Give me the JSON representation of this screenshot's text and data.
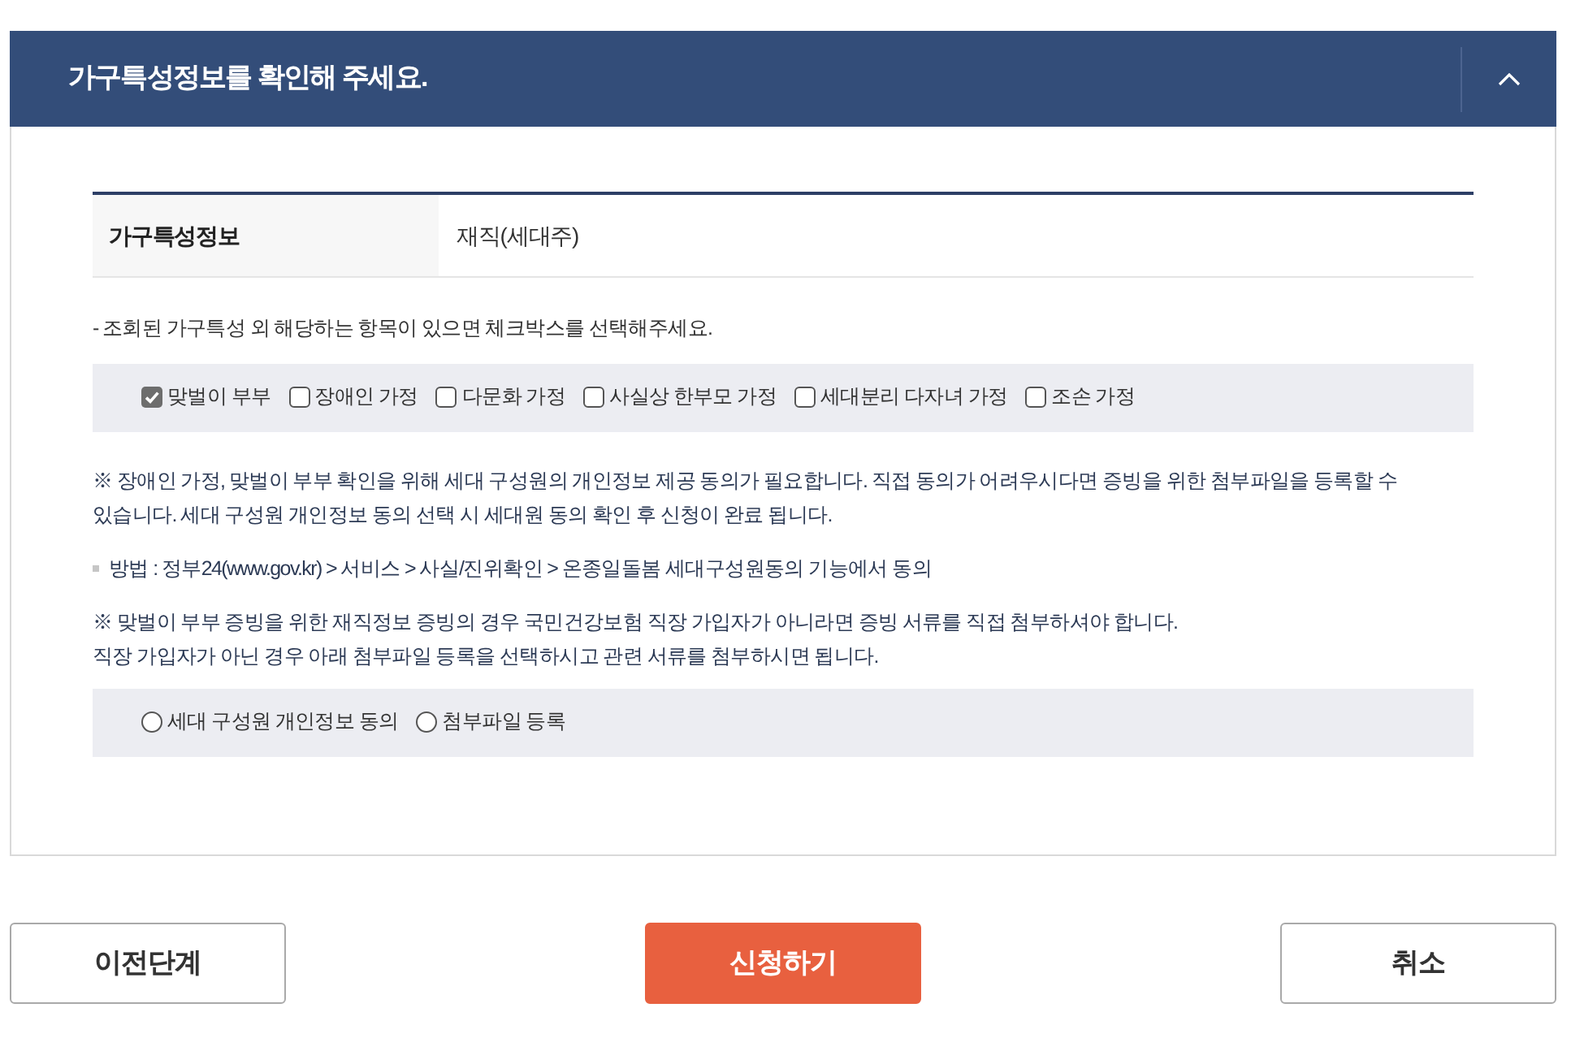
{
  "section": {
    "title": "가구특성정보를 확인해 주세요.",
    "expanded": true
  },
  "info_table": {
    "rows": [
      {
        "label": "가구특성정보",
        "value": "재직(세대주)"
      }
    ]
  },
  "instruction": "- 조회된 가구특성 외 해당하는 항목이 있으면 체크박스를 선택해주세요.",
  "household_types": [
    {
      "label": "맞벌이 부부",
      "checked": true
    },
    {
      "label": "장애인 가정",
      "checked": false
    },
    {
      "label": "다문화 가정",
      "checked": false
    },
    {
      "label": "사실상 한부모 가정",
      "checked": false
    },
    {
      "label": "세대분리 다자녀 가정",
      "checked": false
    },
    {
      "label": "조손 가정",
      "checked": false
    }
  ],
  "notices": [
    {
      "kind": "note",
      "lines": [
        "※ 장애인 가정, 맞벌이 부부 확인을 위해 세대 구성원의 개인정보 제공 동의가 필요합니다. 직접 동의가 어려우시다면 증빙을 위한 첨부파일을 등록할 수 있습니다. 세대 구성원 개인정보 동의 선택 시 세대원 동의 확인 후 신청이 완료 됩니다."
      ]
    },
    {
      "kind": "bullet",
      "lines": [
        "방법 : 정부24(www.gov.kr) > 서비스 > 사실/진위확인 > 온종일돌봄 세대구성원동의 기능에서 동의"
      ]
    },
    {
      "kind": "note",
      "lines": [
        "※ 맞벌이 부부 증빙을 위한 재직정보 증빙의 경우 국민건강보험 직장 가입자가 아니라면 증빙 서류를 직접 첨부하셔야 합니다.",
        "직장 가입자가 아닌 경우 아래 첨부파일 등록을 선택하시고 관련 서류를 첨부하시면 됩니다."
      ]
    }
  ],
  "consent_options": [
    {
      "label": "세대 구성원 개인정보 동의",
      "selected": false
    },
    {
      "label": "첨부파일 등록",
      "selected": false
    }
  ],
  "buttons": [
    {
      "label": "이전단계",
      "kind": "secondary"
    },
    {
      "label": "신청하기",
      "kind": "primary"
    },
    {
      "label": "취소",
      "kind": "secondary"
    }
  ]
}
